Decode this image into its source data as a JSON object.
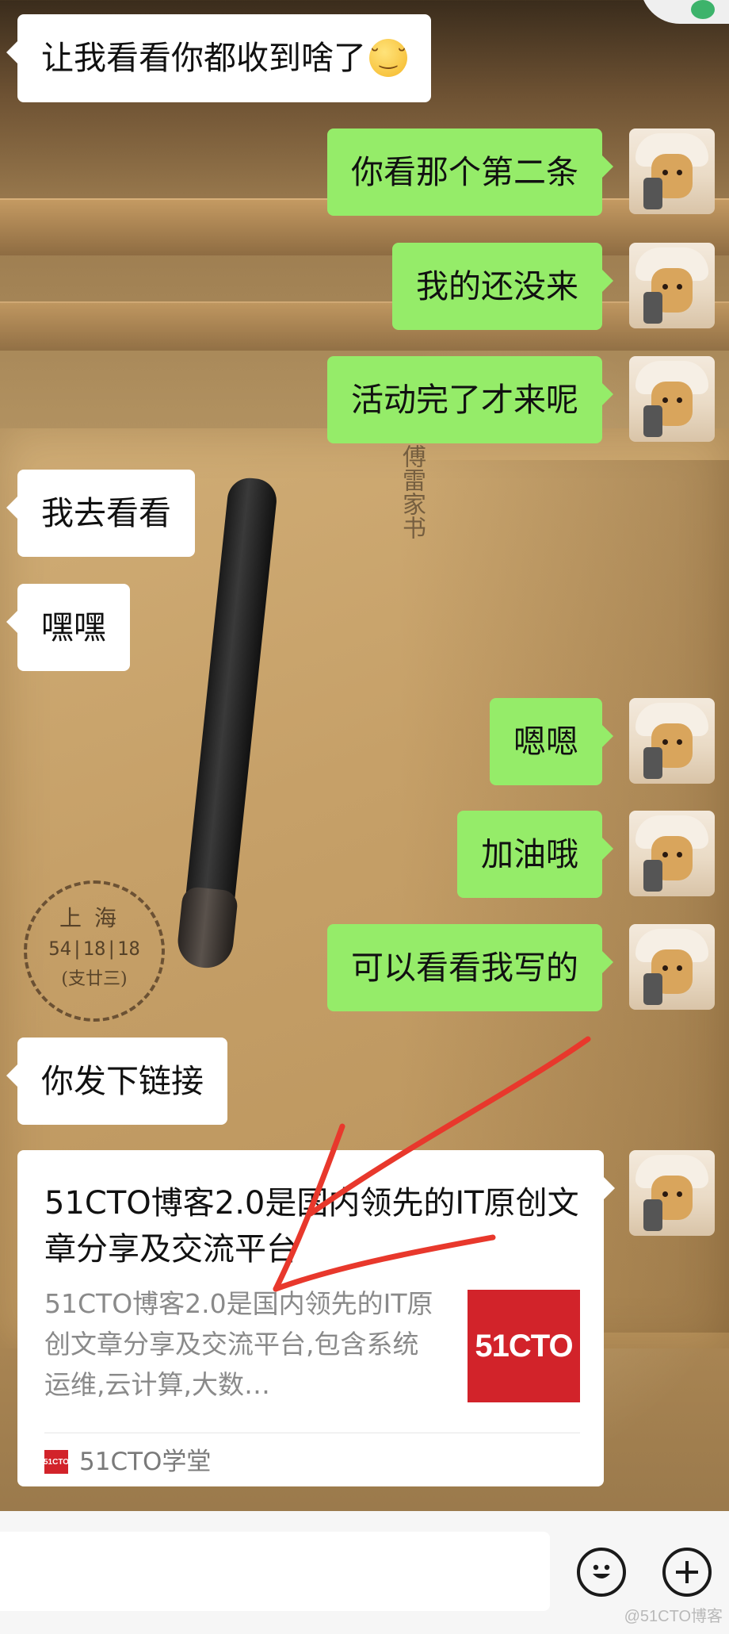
{
  "messages": [
    {
      "side": "in",
      "text": "让我看看你都收到啥了",
      "emoji": "smirk-emoji"
    },
    {
      "side": "out",
      "text": "你看那个第二条"
    },
    {
      "side": "out",
      "text": "我的还没来"
    },
    {
      "side": "out",
      "text": "活动完了才来呢"
    },
    {
      "side": "in",
      "text": "我去看看"
    },
    {
      "side": "in",
      "text": "嘿嘿"
    },
    {
      "side": "out",
      "text": "嗯嗯"
    },
    {
      "side": "out",
      "text": "加油哦"
    },
    {
      "side": "out",
      "text": "可以看看我写的"
    },
    {
      "side": "in",
      "text": "你发下链接"
    }
  ],
  "link_card": {
    "title": "51CTO博客2.0是国内领先的IT原创文章分享及交流平台",
    "description": "51CTO博客2.0是国内领先的IT原创文章分享及交流平台,包含系统运维,云计算,大数…",
    "thumbnail_text": "51CTO",
    "source_logo_text": "51CTO",
    "source_name": "51CTO学堂"
  },
  "background_photo": {
    "stamp_line1": "上海",
    "stamp_line2": "54|18|18",
    "stamp_line3": "(支廿三)",
    "book_title": "傅雷家书"
  },
  "bottom_bar": {
    "emoji_icon": "smiley-icon",
    "plus_icon": "plus-icon"
  },
  "watermark": "@51CTO博客",
  "colors": {
    "outgoing_bubble": "#95ec69",
    "incoming_bubble": "#ffffff",
    "annotation_red": "#e8382c",
    "brand_red": "#d2232a"
  }
}
